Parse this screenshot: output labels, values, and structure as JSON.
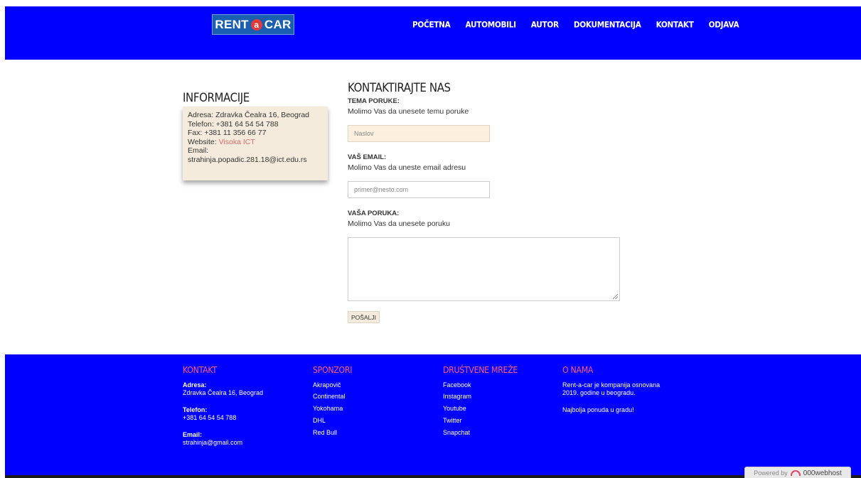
{
  "header": {
    "logo_left": "RENT",
    "logo_mid": "a",
    "logo_right": "CAR",
    "nav": [
      "POČETNA",
      "AUTOMOBILI",
      "AUTOR",
      "DOKUMENTACIJA",
      "KONTAKT",
      "ODJAVA"
    ]
  },
  "info": {
    "title": "INFORMACIJE",
    "address": "Adresa: Zdravka Čealra 16, Beograd",
    "phone": "Telefon: +381 64 54 54 788",
    "fax": "Fax: +381 11 356 66 77",
    "website_label": "Website: ",
    "website_link": "Visoka ICT",
    "email_label": "Email:",
    "email": "strahinja.popadic.281.18@ict.edu.rs"
  },
  "form": {
    "title": "KONTAKTIRAJTE NAS",
    "subject_label": "TEMA PORUKE:",
    "subject_hint": "Molimo Vas da unesete temu poruke",
    "subject_placeholder": "Naslov",
    "email_label": "VAŠ EMAIL:",
    "email_hint": "Molimo Vas da uneste email adresu",
    "email_placeholder": "primer@nesto.com",
    "message_label": "VAŠA PORUKA:",
    "message_hint": "Molimo Vas da unesete poruku",
    "submit": "POŠALJI"
  },
  "footer": {
    "contact": {
      "title": "KONTAKT",
      "address_label": "Adresa:",
      "address": "Zdravka Čealra 16, Beograd",
      "phone_label": "Telefon:",
      "phone": "+381 64 54 54 788",
      "email_label": "Email:",
      "email": "strahinja@gmail.com"
    },
    "sponsors": {
      "title": "SPONZORI",
      "items": [
        "Akrapovič",
        "Continental",
        "Yokohama",
        "DHL",
        "Red Bull"
      ]
    },
    "social": {
      "title": "DRUŠTVENE MREŽE",
      "items": [
        "Facebook",
        "Instagram",
        "Youtube",
        "Twitter",
        "Snapchat"
      ]
    },
    "about": {
      "title": "O NAMA",
      "line1": "Rent-a-car je kompanija osnovana",
      "line2": "2019. godine u beogradu.",
      "line3": "Najbolja ponuda u gradu!"
    }
  },
  "powered": {
    "label": "Powered by",
    "brand": "000webhost"
  },
  "colors": {
    "header_bg": "#0000ff",
    "footer_title": "#ff5a7a",
    "info_box_bg": "#f5ebdc",
    "link": "#e06a6a"
  }
}
